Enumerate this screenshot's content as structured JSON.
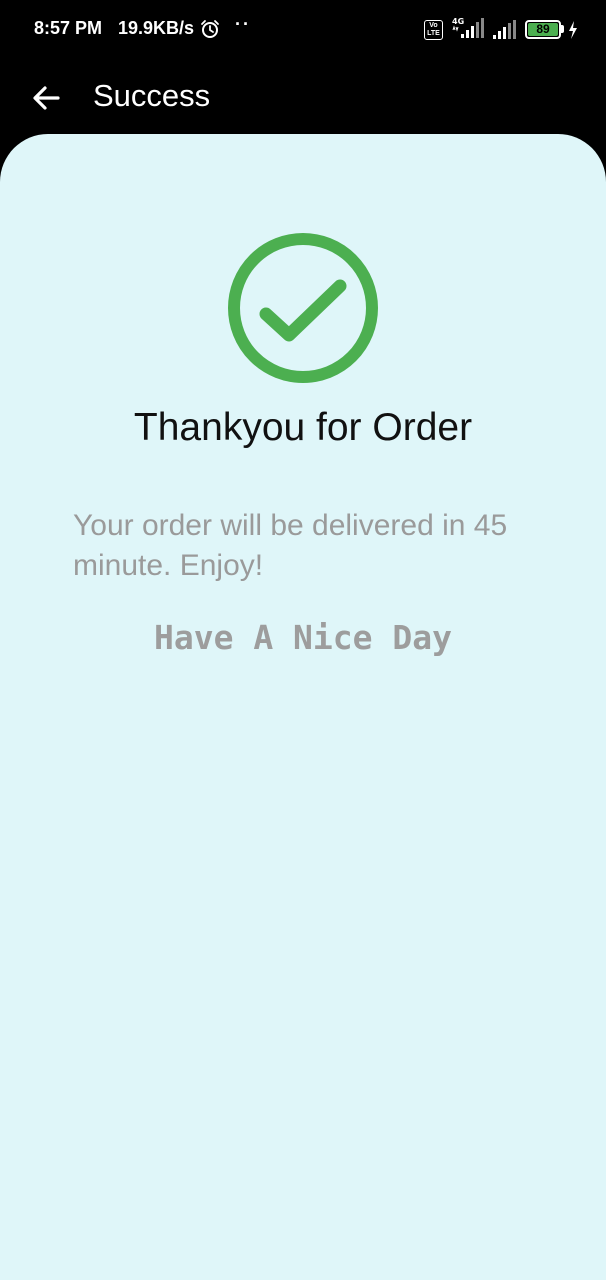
{
  "status_bar": {
    "time": "8:57 PM",
    "network_speed": "19.9KB/s",
    "dots": "··",
    "volte_top": "Vo",
    "volte_bottom": "LTE",
    "network_type": "4G",
    "battery_level": "89",
    "icons": [
      "alarm-icon",
      "volte-icon",
      "signal-4g-icon",
      "signal-icon",
      "battery-icon",
      "charging-icon"
    ]
  },
  "app_bar": {
    "title": "Success",
    "back_icon": "arrow-left-icon"
  },
  "content": {
    "success_icon": "check-circle-icon",
    "title": "Thankyou for Order",
    "message": "Your order will be delivered in 45 minute. Enjoy!",
    "closing": "Have A Nice Day"
  },
  "colors": {
    "background": "#000000",
    "card_background": "#dff6f9",
    "success_green": "#4caf50",
    "title_text": "#111111",
    "secondary_text": "#9a9a9a"
  }
}
